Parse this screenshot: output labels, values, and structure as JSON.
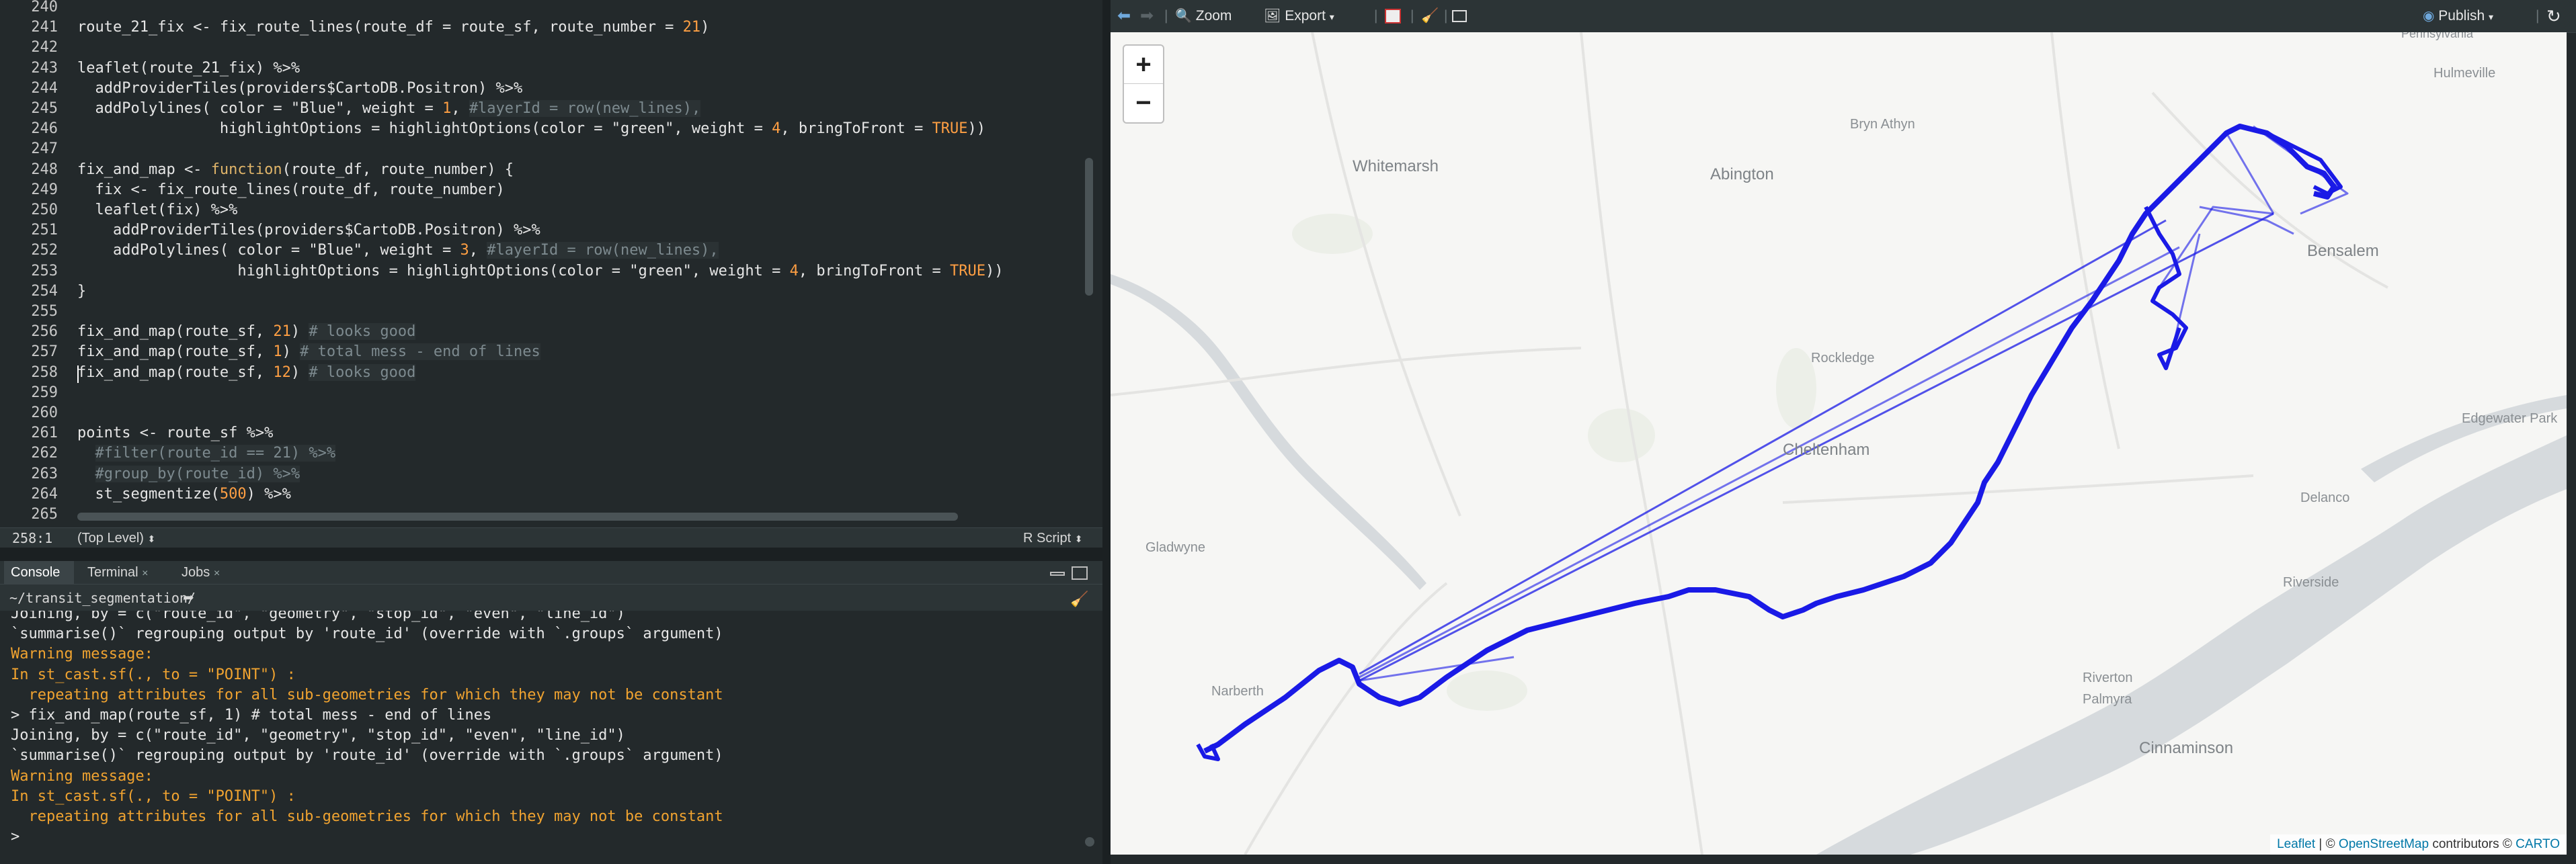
{
  "editor": {
    "lines": [
      {
        "n": "240",
        "html": ""
      },
      {
        "n": "241",
        "html": "route_21_fix <- fix_route_lines(route_df = route_sf, route_number = <span class=\"num\">21</span>)"
      },
      {
        "n": "242",
        "html": ""
      },
      {
        "n": "243",
        "html": "leaflet(route_21_fix) %>%"
      },
      {
        "n": "244",
        "html": "  addProviderTiles(providers$CartoDB.Positron) %>%"
      },
      {
        "n": "245",
        "html": "  addPolylines( color = \"Blue\", weight = <span class=\"num\">1</span>, <span class=\"cmt\">#layerId = row(new_lines),</span>"
      },
      {
        "n": "246",
        "html": "                highlightOptions = highlightOptions(color = \"green\", weight = <span class=\"num\">4</span>, bringToFront = <span class=\"num\">TRUE</span>))"
      },
      {
        "n": "247",
        "html": ""
      },
      {
        "n": "248",
        "html": "fix_and_map <- <span class=\"kw\">function</span>(route_df, route_number) {"
      },
      {
        "n": "249",
        "html": "  fix <- fix_route_lines(route_df, route_number)"
      },
      {
        "n": "250",
        "html": "  leaflet(fix) %>%"
      },
      {
        "n": "251",
        "html": "    addProviderTiles(providers$CartoDB.Positron) %>%"
      },
      {
        "n": "252",
        "html": "    addPolylines( color = \"Blue\", weight = <span class=\"num\">3</span>, <span class=\"cmt\">#layerId = row(new_lines),</span>"
      },
      {
        "n": "253",
        "html": "                  highlightOptions = highlightOptions(color = \"green\", weight = <span class=\"num\">4</span>, bringToFront = <span class=\"num\">TRUE</span>))"
      },
      {
        "n": "254",
        "html": "}"
      },
      {
        "n": "255",
        "html": ""
      },
      {
        "n": "256",
        "html": "fix_and_map(route_sf, <span class=\"num\">21</span>) <span class=\"cmt\"># looks good</span>"
      },
      {
        "n": "257",
        "html": "fix_and_map(route_sf, <span class=\"num\">1</span>) <span class=\"cmt\"># total mess - end of lines</span>"
      },
      {
        "n": "258",
        "html": "fix_and_map(route_sf, <span class=\"num\">12</span>) <span class=\"cmt\"># looks good</span>"
      },
      {
        "n": "259",
        "html": ""
      },
      {
        "n": "260",
        "html": ""
      },
      {
        "n": "261",
        "html": "points <- route_sf %>%"
      },
      {
        "n": "262",
        "html": "  <span class=\"cmt\">#filter(route_id == 21) %>%</span>"
      },
      {
        "n": "263",
        "html": "  <span class=\"cmt\">#group_by(route_id) %>%</span>"
      },
      {
        "n": "264",
        "html": "  st_segmentize(<span class=\"num\">500</span>) %>%"
      },
      {
        "n": "265",
        "html": ""
      }
    ]
  },
  "status": {
    "position": "258:1",
    "scope": "(Top Level)",
    "filetype": "R Script"
  },
  "console_tabs": [
    "Console",
    "Terminal",
    "Jobs"
  ],
  "console_path": "~/transit_segmentation/",
  "console": {
    "lines": [
      {
        "cls": "out",
        "text": "Joining, by = c(\"route_id\", \"geometry\", \"stop_id\", \"even\", \"line_id\")"
      },
      {
        "cls": "out",
        "text": "`summarise()` regrouping output by 'route_id' (override with `.groups` argument)"
      },
      {
        "cls": "warn",
        "text": "Warning message:"
      },
      {
        "cls": "warn",
        "text": "In st_cast.sf(., to = \"POINT\") :"
      },
      {
        "cls": "warn",
        "text": "  repeating attributes for all sub-geometries for which they may not be constant"
      },
      {
        "cls": "in",
        "text": "> fix_and_map(route_sf, 1) # total mess - end of lines"
      },
      {
        "cls": "out",
        "text": "Joining, by = c(\"route_id\", \"geometry\", \"stop_id\", \"even\", \"line_id\")"
      },
      {
        "cls": "out",
        "text": "`summarise()` regrouping output by 'route_id' (override with `.groups` argument)"
      },
      {
        "cls": "warn",
        "text": "Warning message:"
      },
      {
        "cls": "warn",
        "text": "In st_cast.sf(., to = \"POINT\") :"
      },
      {
        "cls": "warn",
        "text": "  repeating attributes for all sub-geometries for which they may not be constant"
      },
      {
        "cls": "in",
        "text": "> "
      }
    ]
  },
  "viewer": {
    "zoom_label": "Zoom",
    "export_label": "Export",
    "publish_label": "Publish"
  },
  "map": {
    "places": [
      "Pennsylvania",
      "Bryn Athyn",
      "Hulmeville",
      "Whitemarsh",
      "Abington",
      "Bensalem",
      "Rockledge",
      "Cheltenham",
      "Edgewater Park",
      "Delanco",
      "Gladwyne",
      "Riverside",
      "Narberth",
      "Riverton",
      "Palmyra",
      "Cinnaminson"
    ],
    "zoom_in": "+",
    "zoom_out": "−",
    "attribution": {
      "leaflet": "Leaflet",
      "sep": " | © ",
      "osm": "OpenStreetMap",
      "contrib": " contributors © ",
      "carto": "CARTO"
    },
    "colors": {
      "route": "#1a1ae6",
      "land": "#f6f6f4",
      "water": "#d6dadd"
    }
  }
}
